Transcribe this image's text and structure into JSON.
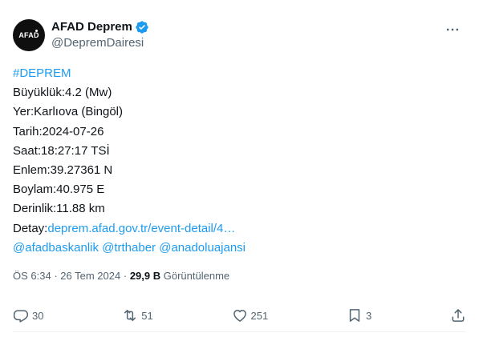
{
  "account": {
    "avatar_text": "AFAD",
    "display_name": "AFAD Deprem",
    "handle": "@DepremDairesi"
  },
  "icons": {
    "verified": "verified-badge-icon",
    "more": "more-icon",
    "reply": "reply-icon",
    "retweet": "retweet-icon",
    "like": "heart-icon",
    "bookmark": "bookmark-icon",
    "share": "share-icon"
  },
  "tweet": {
    "hashtag": "#DEPREM",
    "lines": [
      "Büyüklük:4.2 (Mw)",
      "Yer:Karlıova (Bingöl)",
      "Tarih:2024-07-26",
      "Saat:18:27:17 TSİ",
      "Enlem:39.27361 N",
      "Boylam:40.975 E",
      "Derinlik:11.88 km"
    ],
    "detail_label": "Detay:",
    "detail_link": "deprem.afad.gov.tr/event-detail/4…",
    "mentions": "@afadbaskanlik @trthaber @anadoluajansi"
  },
  "meta": {
    "time": "ÖS 6:34",
    "date": "26 Tem 2024",
    "separator": "·",
    "views": "29,9 B",
    "views_label": "Görüntülenme"
  },
  "actions": {
    "replies": "30",
    "retweets": "51",
    "likes": "251",
    "bookmarks": "3"
  },
  "colors": {
    "link": "#1d9bf0",
    "verified": "#1d9bf0",
    "secondary_text": "#536471"
  }
}
